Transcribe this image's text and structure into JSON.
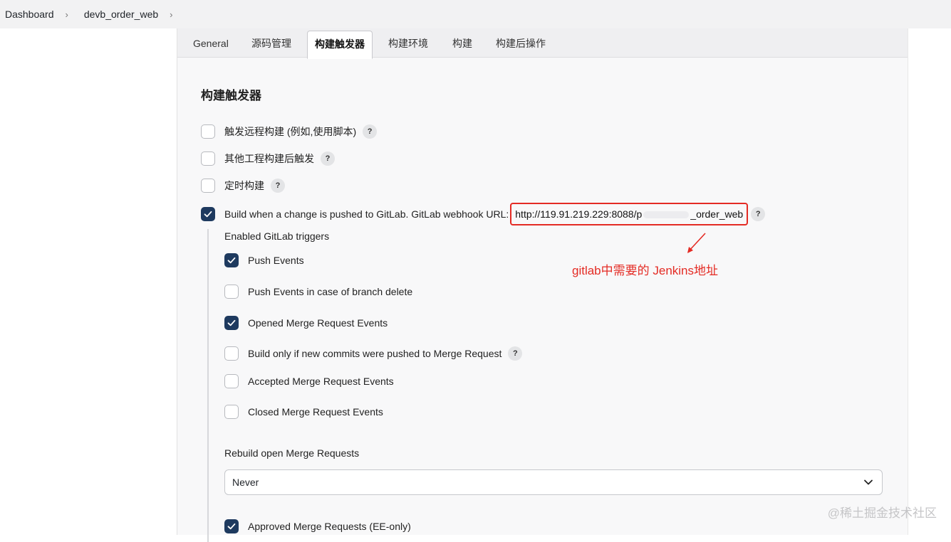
{
  "breadcrumb": {
    "items": [
      "Dashboard",
      "devb_order_web"
    ]
  },
  "tabs": [
    "General",
    "源码管理",
    "构建触发器",
    "构建环境",
    "构建",
    "构建后操作"
  ],
  "active_tab": "构建触发器",
  "section": {
    "title": "构建触发器"
  },
  "triggers": {
    "remote": {
      "label": "触发远程构建 (例如,使用脚本)",
      "checked": false
    },
    "after_other": {
      "label": "其他工程构建后触发",
      "checked": false
    },
    "timer": {
      "label": "定时构建",
      "checked": false
    },
    "gitlab": {
      "label": "Build when a change is pushed to GitLab. GitLab webhook URL:",
      "url_prefix": "http://119.91.219.229:8088/p",
      "url_suffix": "_order_web",
      "checked": true
    }
  },
  "gitlab_triggers": {
    "heading": "Enabled GitLab triggers",
    "items": [
      {
        "label": "Push Events",
        "checked": true
      },
      {
        "label": "Push Events in case of branch delete",
        "checked": false
      },
      {
        "label": "Opened Merge Request Events",
        "checked": true
      },
      {
        "label": "Build only if new commits were pushed to Merge Request",
        "checked": false
      },
      {
        "label": "Accepted Merge Request Events",
        "checked": false
      },
      {
        "label": "Closed Merge Request Events",
        "checked": false
      }
    ]
  },
  "rebuild": {
    "label": "Rebuild open Merge Requests",
    "value": "Never"
  },
  "approved": {
    "label": "Approved Merge Requests (EE-only)",
    "checked": true
  },
  "help_glyph": "?",
  "annotation": "gitlab中需要的 Jenkins地址",
  "watermark": "@稀土掘金技术社区",
  "colors": {
    "checkbox_checked": "#1e3a5f",
    "annotation": "#e42b24"
  }
}
